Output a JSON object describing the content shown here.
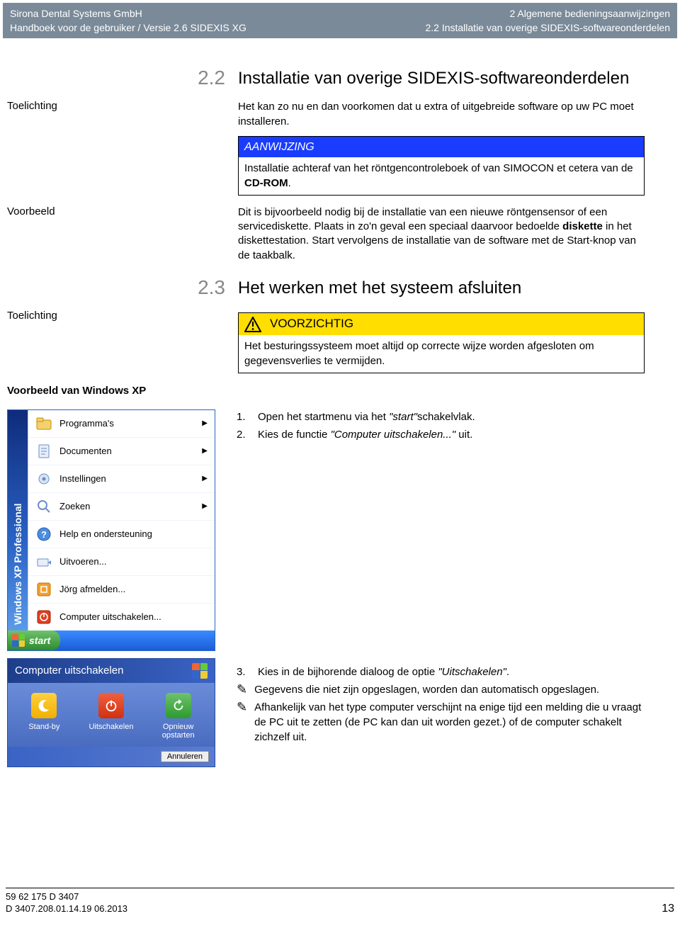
{
  "header": {
    "left1": "Sirona Dental Systems GmbH",
    "right1": "2 Algemene bedieningsaanwijzingen",
    "left2": "Handboek voor de gebruiker / Versie 2.6 SIDEXIS XG",
    "right2": "2.2 Installatie van overige SIDEXIS-softwareonderdelen"
  },
  "sec22": {
    "num": "2.2",
    "title": "Installatie van overige SIDEXIS-softwareonderdelen",
    "toelichting_label": "Toelichting",
    "toelichting_text": "Het kan zo nu en dan voorkomen dat u extra of uitgebreide software op uw PC moet installeren.",
    "note_title": "AANWIJZING",
    "note_body_a": "Installatie achteraf van het röntgencontroleboek of van SIMOCON et cetera van de ",
    "note_body_b": "CD-ROM",
    "note_body_c": ".",
    "voorbeeld_label": "Voorbeeld",
    "voorbeeld_a": "Dit is bijvoorbeeld nodig bij de installatie van een nieuwe röntgensensor of een servicediskette. Plaats in zo'n geval een speciaal daarvoor bedoelde ",
    "voorbeeld_b": "diskette",
    "voorbeeld_c": " in het diskettestation. Start vervolgens de installatie van de software met de Start-knop van de taakbalk."
  },
  "sec23": {
    "num": "2.3",
    "title": "Het werken met het systeem afsluiten",
    "toelichting_label": "Toelichting",
    "caution_title": "VOORZICHTIG",
    "caution_body": "Het besturingssysteem moet altijd op correcte wijze worden afgesloten om gegevensverlies te vermijden.",
    "voorbeeld_label": "Voorbeeld van Windows XP"
  },
  "xp_menu": {
    "side_label": "Windows XP Professional",
    "items": [
      {
        "label": "Programma's",
        "arrow": true,
        "icon": "folder-app-icon"
      },
      {
        "label": "Documenten",
        "arrow": true,
        "icon": "document-icon"
      },
      {
        "label": "Instellingen",
        "arrow": true,
        "icon": "settings-icon"
      },
      {
        "label": "Zoeken",
        "arrow": true,
        "icon": "search-icon"
      },
      {
        "label": "Help en ondersteuning",
        "arrow": false,
        "icon": "help-icon"
      },
      {
        "label": "Uitvoeren...",
        "arrow": false,
        "icon": "run-icon"
      },
      {
        "label": "Jörg afmelden...",
        "arrow": false,
        "icon": "logoff-icon"
      },
      {
        "label": "Computer uitschakelen...",
        "arrow": false,
        "icon": "shutdown-icon"
      }
    ],
    "start": "start"
  },
  "shutdown": {
    "title": "Computer uitschakelen",
    "opt1": "Stand-by",
    "opt2": "Uitschakelen",
    "opt3": "Opnieuw opstarten",
    "cancel": "Annuleren"
  },
  "steps_top": {
    "s1n": "1.",
    "s1a": "Open het startmenu via het ",
    "s1b": "\"start\"",
    "s1c": "schakelvlak.",
    "s2n": "2.",
    "s2a": "Kies de functie ",
    "s2b": "\"Computer uitschakelen...\"",
    "s2c": " uit."
  },
  "steps_bottom": {
    "s3n": "3.",
    "s3a": "Kies in de bijhorende dialoog de optie ",
    "s3b": "\"Uitschakelen\"",
    "s3c": ".",
    "r1": "Gegevens die niet zijn opgeslagen, worden dan automatisch opgeslagen.",
    "r2": "Afhankelijk van het type computer verschijnt na enige tijd een melding die u vraagt de PC uit te zetten (de PC kan dan uit worden gezet.) of de computer schakelt zichzelf uit."
  },
  "footer": {
    "l1": "59 62 175 D 3407",
    "l2": "D 3407.208.01.14.19   06.2013",
    "page": "13"
  }
}
